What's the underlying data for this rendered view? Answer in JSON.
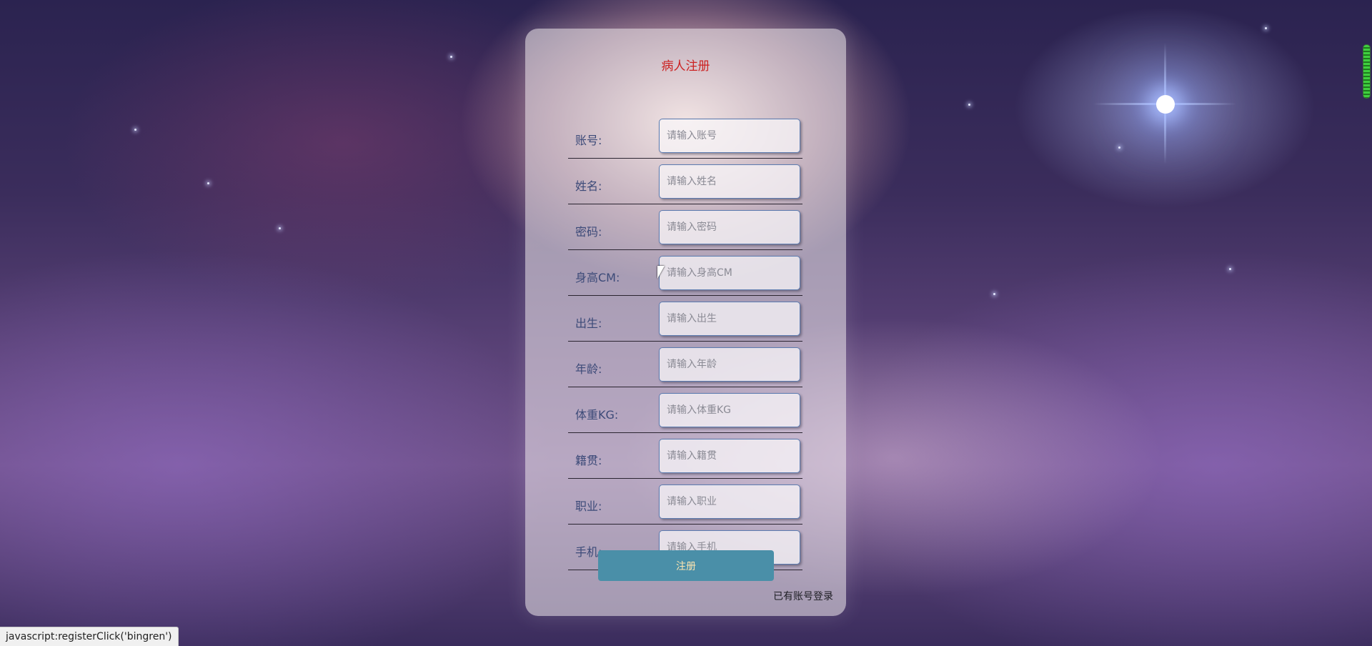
{
  "form": {
    "title": "病人注册",
    "fields": [
      {
        "label": "账号:",
        "placeholder": "请输入账号",
        "value": ""
      },
      {
        "label": "姓名:",
        "placeholder": "请输入姓名",
        "value": ""
      },
      {
        "label": "密码:",
        "placeholder": "请输入密码",
        "value": ""
      },
      {
        "label": "身高CM:",
        "placeholder": "请输入身高CM",
        "value": ""
      },
      {
        "label": "出生:",
        "placeholder": "请输入出生",
        "value": ""
      },
      {
        "label": "年龄:",
        "placeholder": "请输入年龄",
        "value": ""
      },
      {
        "label": "体重KG:",
        "placeholder": "请输入体重KG",
        "value": ""
      },
      {
        "label": "籍贯:",
        "placeholder": "请输入籍贯",
        "value": ""
      },
      {
        "label": "职业:",
        "placeholder": "请输入职业",
        "value": ""
      },
      {
        "label": "手机:",
        "placeholder": "请输入手机",
        "value": ""
      }
    ],
    "register_label": "注册",
    "login_link": "已有账号登录"
  },
  "status_bar": {
    "url": "javascript:registerClick('bingren')"
  },
  "colors": {
    "title": "#cc2222",
    "label": "#3c4a78",
    "button_bg": "#4a8fa8",
    "button_text": "#ffe5b0"
  }
}
